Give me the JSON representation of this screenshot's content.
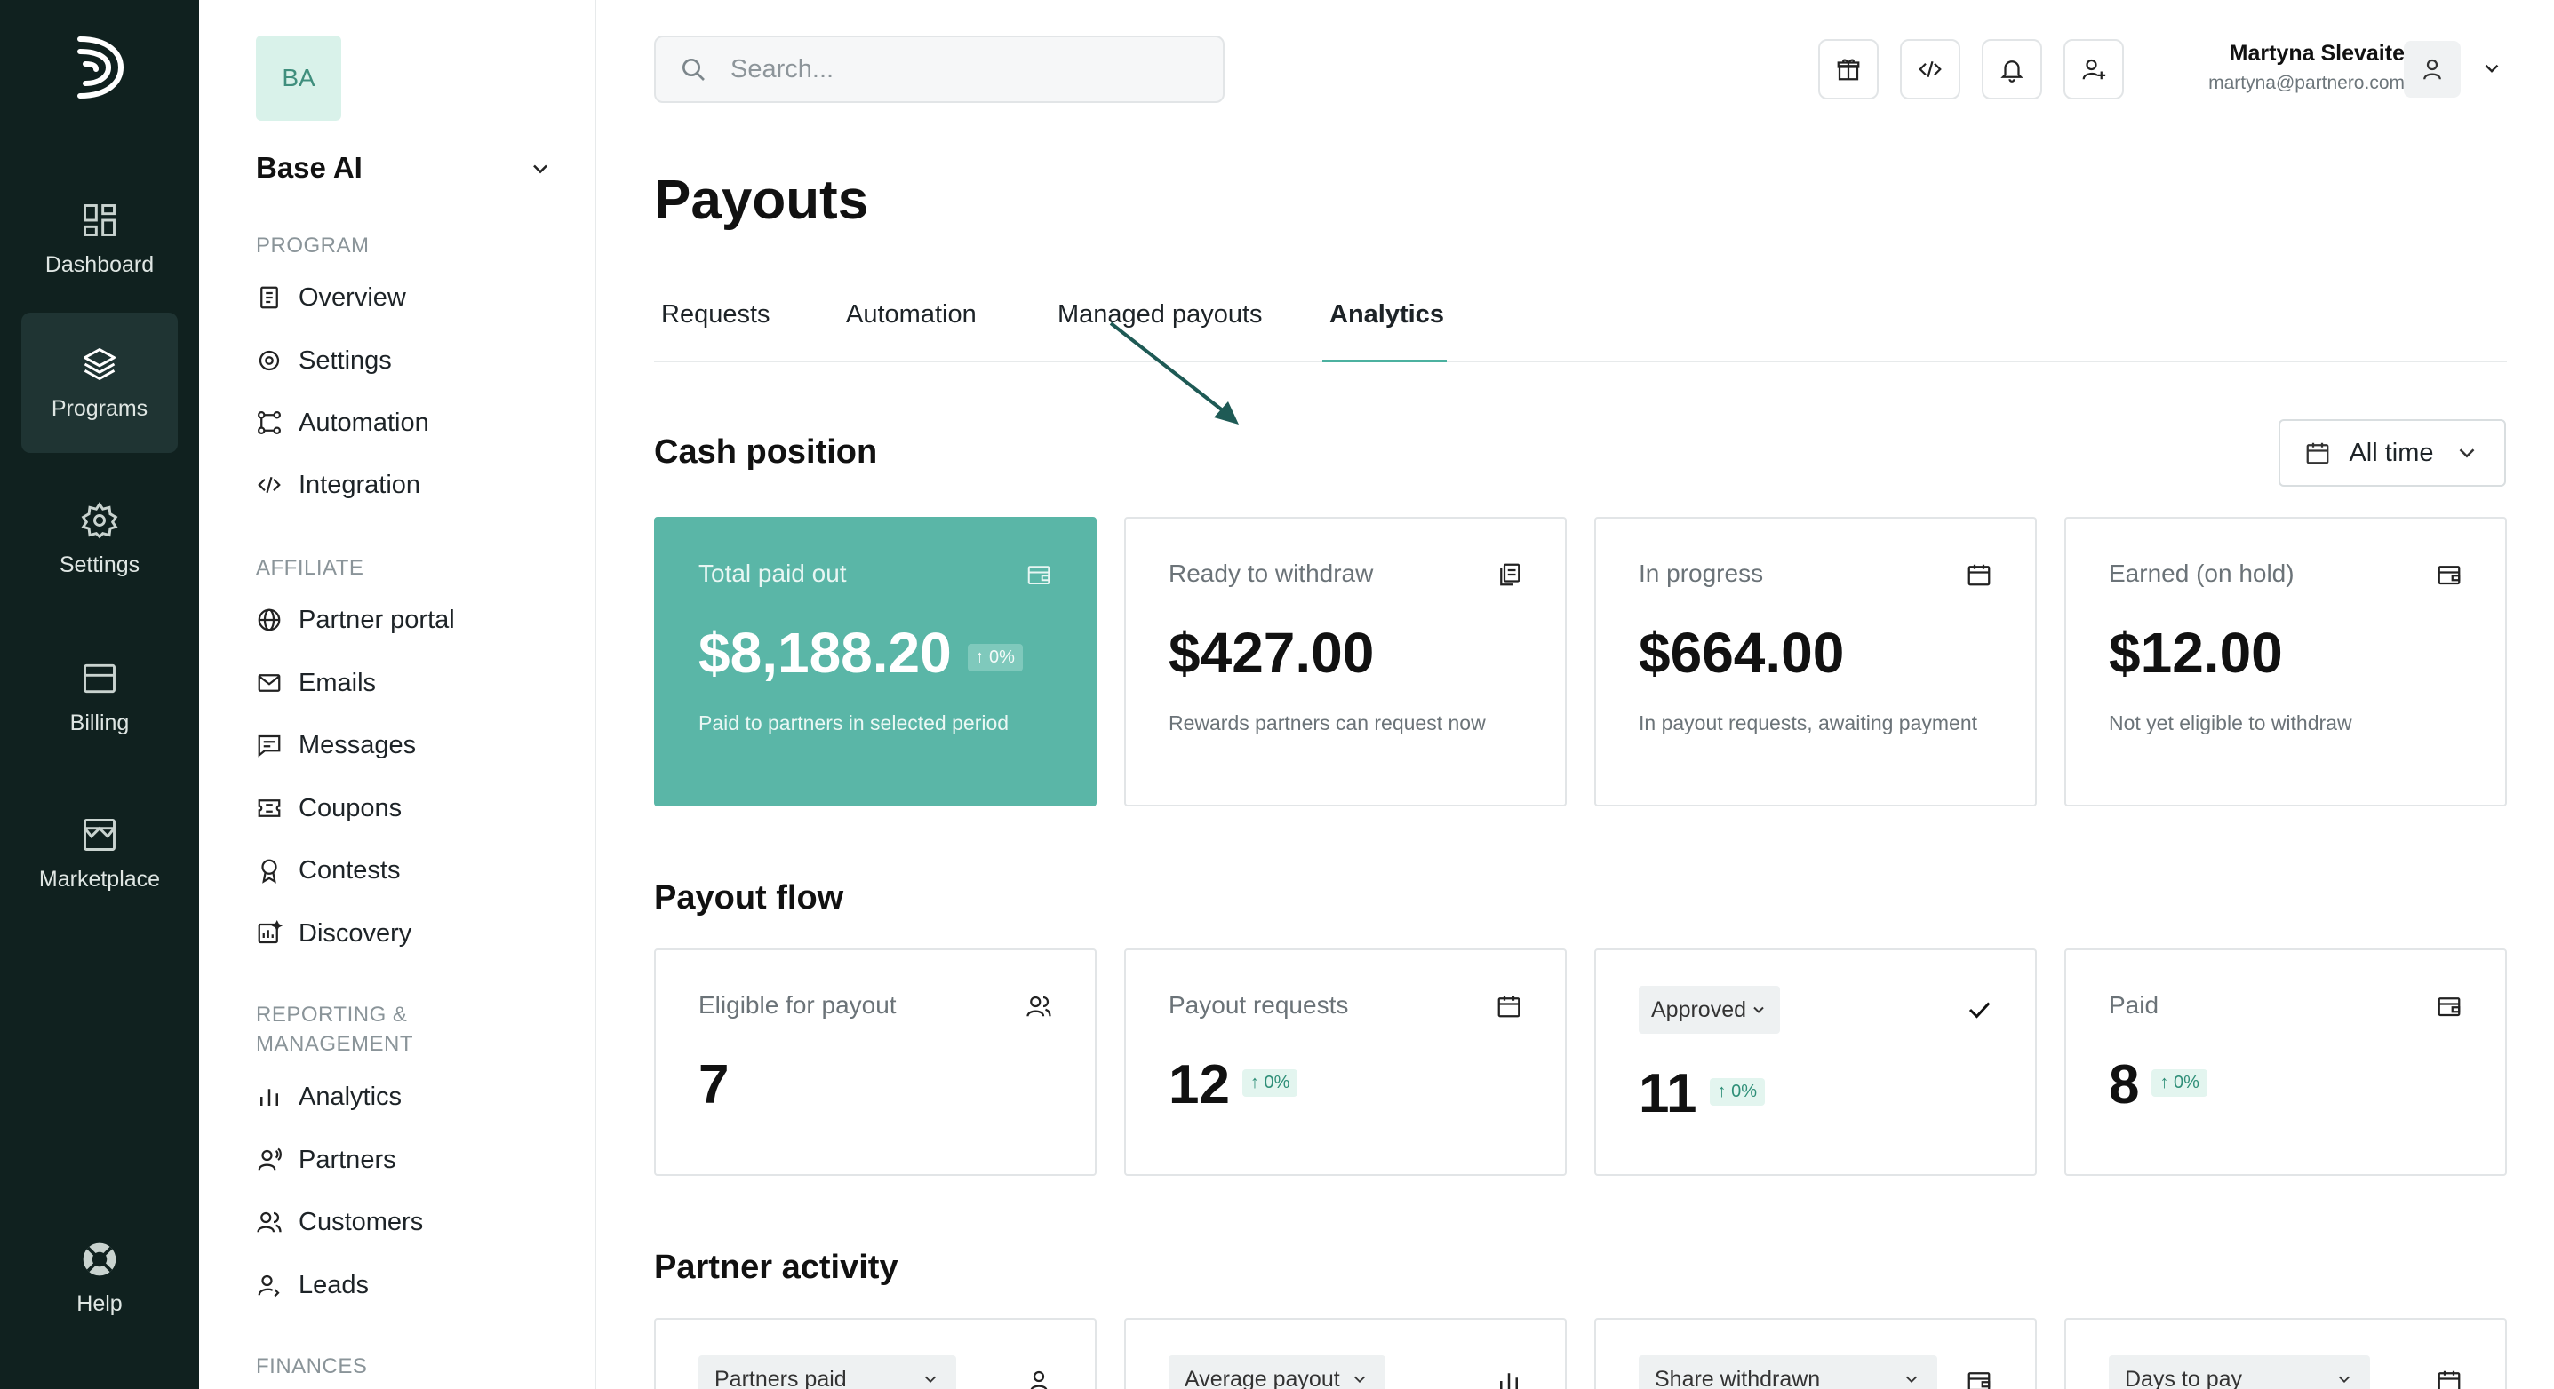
{
  "rail": {
    "items": [
      {
        "label": "Dashboard",
        "icon": "dashboard-icon"
      },
      {
        "label": "Programs",
        "icon": "layers-icon",
        "active": true
      },
      {
        "label": "Settings",
        "icon": "gear-icon"
      },
      {
        "label": "Billing",
        "icon": "billing-icon"
      },
      {
        "label": "Marketplace",
        "icon": "store-icon"
      }
    ],
    "help": "Help"
  },
  "workspace": {
    "initials": "BA",
    "name": "Base AI"
  },
  "sidebar": {
    "program_label": "PROGRAM",
    "program": [
      "Overview",
      "Settings",
      "Automation",
      "Integration"
    ],
    "affiliate_label": "AFFILIATE",
    "affiliate": [
      "Partner portal",
      "Emails",
      "Messages",
      "Coupons",
      "Contests",
      "Discovery"
    ],
    "reporting_label": "REPORTING & MANAGEMENT",
    "reporting": [
      "Analytics",
      "Partners",
      "Customers",
      "Leads"
    ],
    "finances_label": "FINANCES"
  },
  "search": {
    "placeholder": "Search..."
  },
  "user": {
    "name": "Martyna Slevaite",
    "email": "martyna@partnero.com"
  },
  "page": {
    "title": "Payouts"
  },
  "tabs": [
    "Requests",
    "Automation",
    "Managed payouts",
    "Analytics"
  ],
  "active_tab": "Analytics",
  "cash_position": {
    "title": "Cash position",
    "range": "All time",
    "cards": [
      {
        "label": "Total paid out",
        "value": "$8,188.20",
        "delta": "↑ 0%",
        "desc": "Paid to partners in selected period",
        "icon": "wallet-icon"
      },
      {
        "label": "Ready to withdraw",
        "value": "$427.00",
        "desc": "Rewards partners can request now",
        "icon": "documents-icon"
      },
      {
        "label": "In progress",
        "value": "$664.00",
        "desc": "In payout requests, awaiting payment",
        "icon": "calendar-icon"
      },
      {
        "label": "Earned (on hold)",
        "value": "$12.00",
        "desc": "Not yet eligible to withdraw",
        "icon": "wallet-icon"
      }
    ]
  },
  "payout_flow": {
    "title": "Payout flow",
    "cards": [
      {
        "label": "Eligible for payout",
        "value": "7",
        "icon": "users-icon"
      },
      {
        "label": "Payout requests",
        "value": "12",
        "delta": "↑ 0%",
        "icon": "calendar-icon"
      },
      {
        "label": "Approved",
        "value": "11",
        "delta": "↑ 0%",
        "icon": "check-icon"
      },
      {
        "label": "Paid",
        "value": "8",
        "delta": "↑ 0%",
        "icon": "wallet-icon"
      }
    ]
  },
  "partner_activity": {
    "title": "Partner activity",
    "cards": [
      {
        "label": "Partners paid",
        "icon": "user-icon"
      },
      {
        "label": "Average payout",
        "icon": "bar-chart-icon"
      },
      {
        "label": "Share withdrawn",
        "icon": "wallet-icon"
      },
      {
        "label": "Days to pay",
        "icon": "calendar-icon"
      }
    ]
  },
  "colors": {
    "rail_bg": "#10211f",
    "accent": "#5ab6a7",
    "delta_bg": "#e3f5ef",
    "delta_fg": "#2f8f78"
  }
}
